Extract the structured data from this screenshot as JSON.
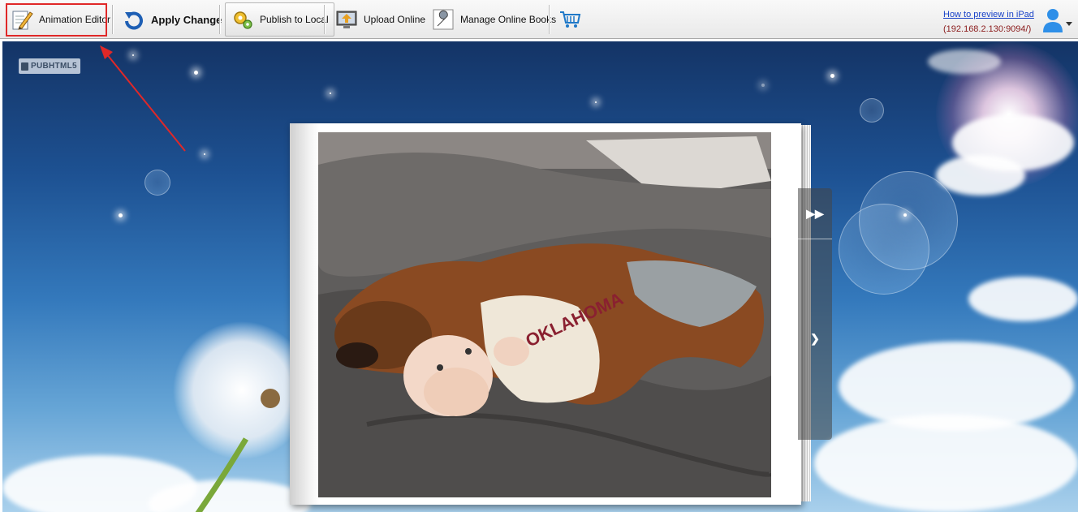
{
  "toolbar": {
    "animation_editor": "Animation Editor",
    "apply_change": "Apply Change",
    "publish_local": "Publish to Local",
    "upload_online": "Upload Online",
    "manage_books": "Manage Online Books",
    "preview_link": "How to preview in iPad",
    "preview_ip": "(192.168.2.130:9094/)"
  },
  "stage": {
    "logo_text": "PUBHTML5"
  },
  "colors": {
    "highlight": "#e02828",
    "link": "#1a43c8",
    "ip": "#8a1a1a"
  },
  "icons": [
    "edit-pencil-icon",
    "refresh-arrow-icon",
    "gear-publish-icon",
    "upload-monitor-icon",
    "wrench-icon",
    "shopping-cart-icon",
    "user-icon",
    "chevron-down-icon",
    "next-page-icon",
    "last-page-icon"
  ]
}
